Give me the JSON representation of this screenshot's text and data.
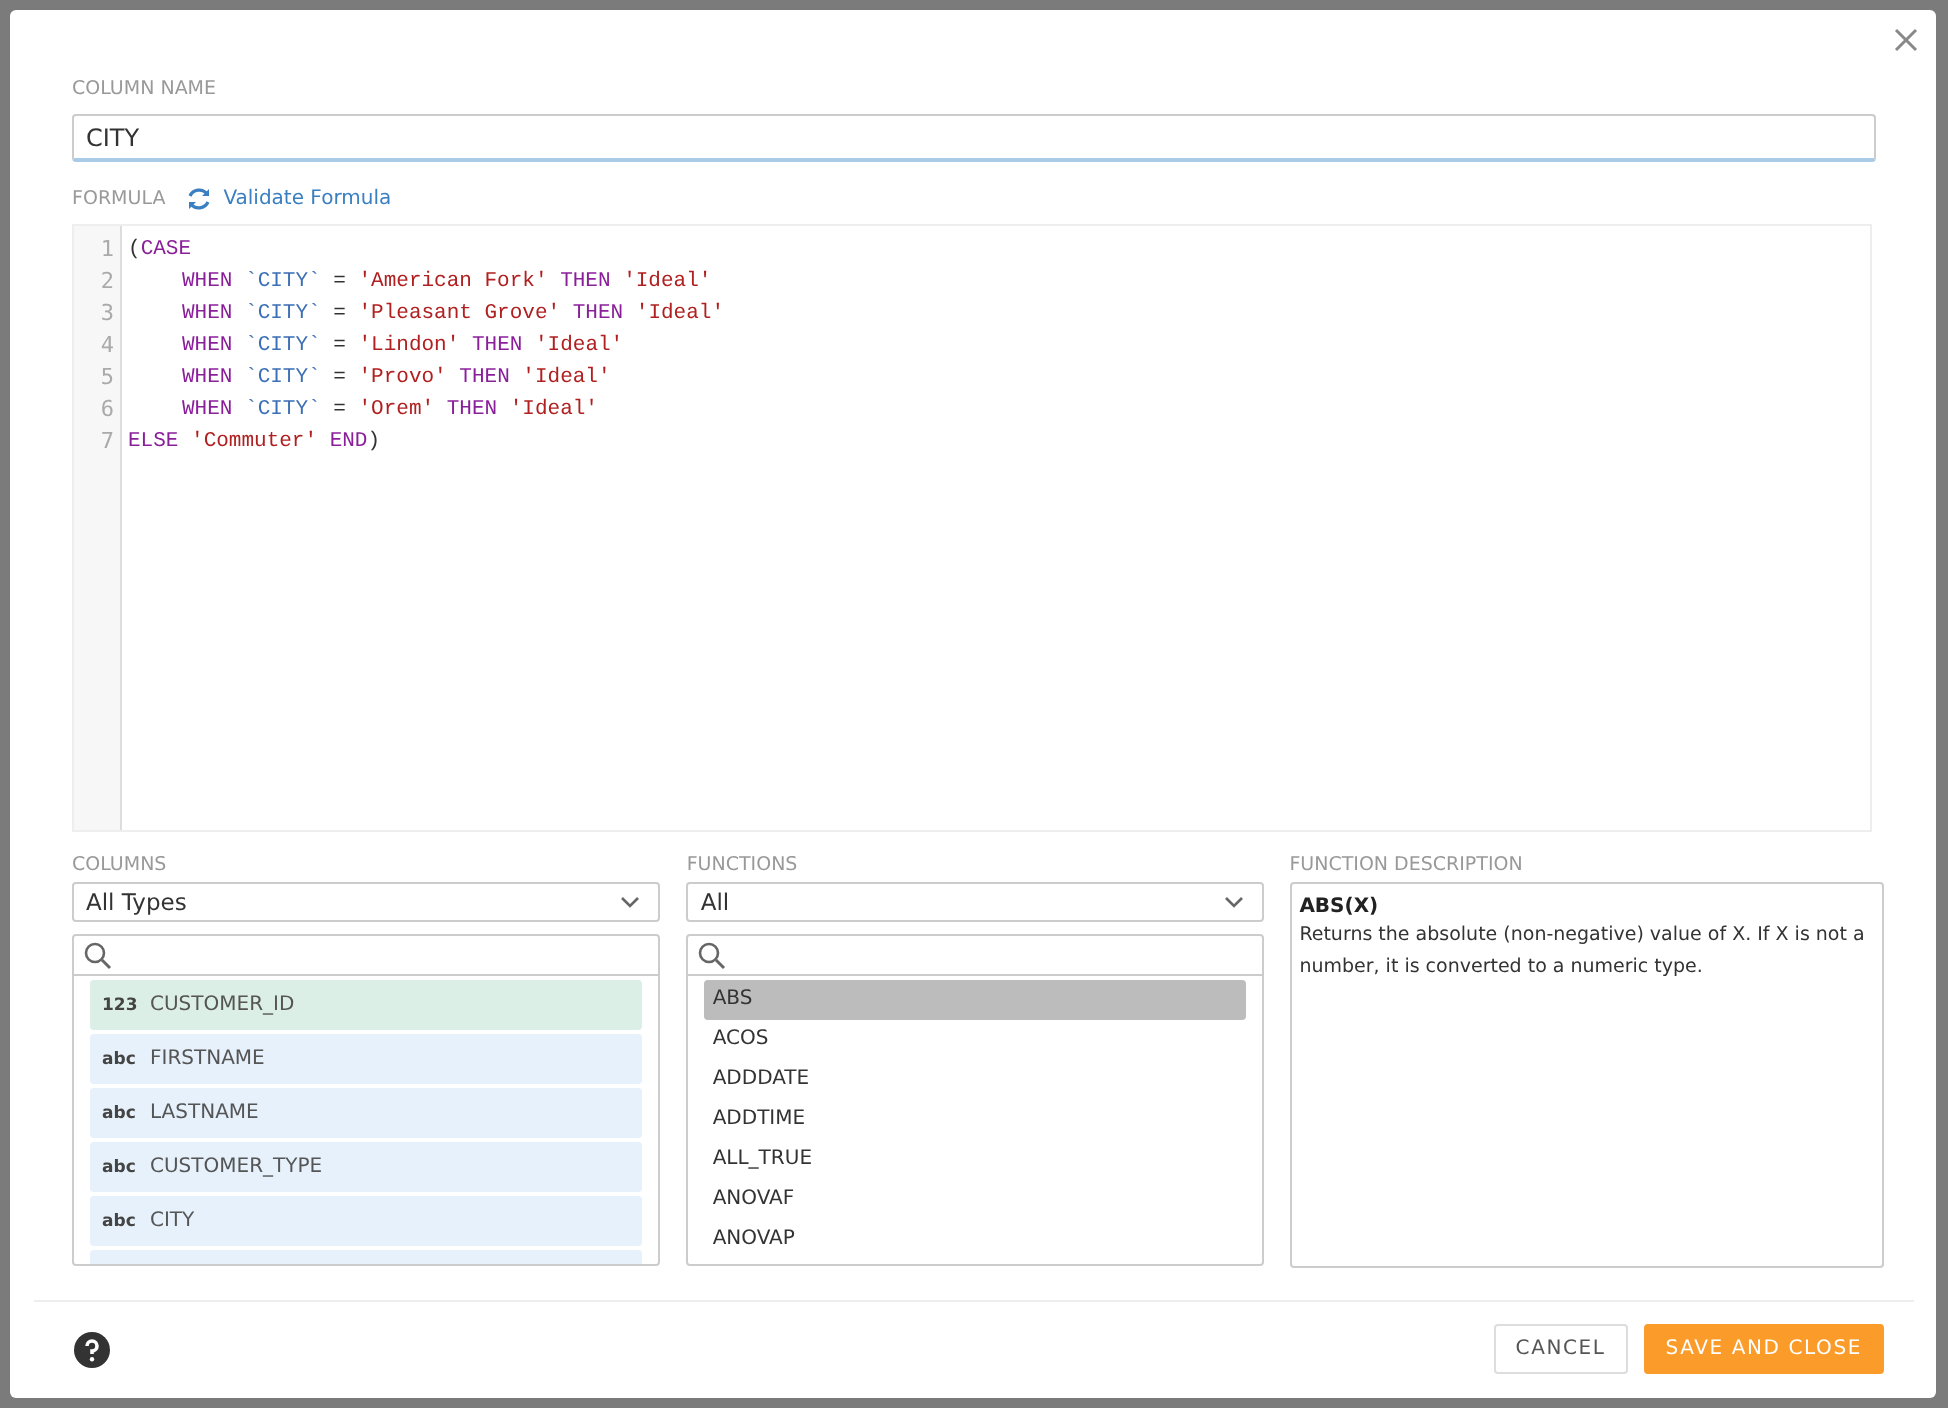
{
  "dialog": {
    "column_name": {
      "label": "COLUMN NAME",
      "value": "CITY"
    },
    "formula": {
      "label": "FORMULA",
      "validate_link": "Validate Formula",
      "lines": [
        {
          "number": "1",
          "indented": false,
          "tokens": [
            {
              "kind": "plain",
              "text": "("
            },
            {
              "kind": "keyword",
              "text": "CASE"
            }
          ]
        },
        {
          "number": "2",
          "indented": true,
          "tokens": [
            {
              "kind": "keyword",
              "text": "WHEN"
            },
            {
              "kind": "column",
              "text": " `CITY` "
            },
            {
              "kind": "plain",
              "text": "= "
            },
            {
              "kind": "string",
              "text": "'American Fork'"
            },
            {
              "kind": "keyword",
              "text": " THEN "
            },
            {
              "kind": "string",
              "text": "'Ideal'"
            }
          ]
        },
        {
          "number": "3",
          "indented": true,
          "tokens": [
            {
              "kind": "keyword",
              "text": "WHEN"
            },
            {
              "kind": "column",
              "text": " `CITY` "
            },
            {
              "kind": "plain",
              "text": "= "
            },
            {
              "kind": "string",
              "text": "'Pleasant Grove'"
            },
            {
              "kind": "keyword",
              "text": " THEN "
            },
            {
              "kind": "string",
              "text": "'Ideal'"
            }
          ]
        },
        {
          "number": "4",
          "indented": true,
          "tokens": [
            {
              "kind": "keyword",
              "text": "WHEN"
            },
            {
              "kind": "column",
              "text": " `CITY` "
            },
            {
              "kind": "plain",
              "text": "= "
            },
            {
              "kind": "string",
              "text": "'Lindon'"
            },
            {
              "kind": "keyword",
              "text": " THEN "
            },
            {
              "kind": "string",
              "text": "'Ideal'"
            }
          ]
        },
        {
          "number": "5",
          "indented": true,
          "tokens": [
            {
              "kind": "keyword",
              "text": "WHEN"
            },
            {
              "kind": "column",
              "text": " `CITY` "
            },
            {
              "kind": "plain",
              "text": "= "
            },
            {
              "kind": "string",
              "text": "'Provo'"
            },
            {
              "kind": "keyword",
              "text": " THEN "
            },
            {
              "kind": "string",
              "text": "'Ideal'"
            }
          ]
        },
        {
          "number": "6",
          "indented": true,
          "tokens": [
            {
              "kind": "keyword",
              "text": "WHEN"
            },
            {
              "kind": "column",
              "text": " `CITY` "
            },
            {
              "kind": "plain",
              "text": "= "
            },
            {
              "kind": "string",
              "text": "'Orem'"
            },
            {
              "kind": "keyword",
              "text": " THEN "
            },
            {
              "kind": "string",
              "text": "'Ideal'"
            }
          ]
        },
        {
          "number": "7",
          "indented": false,
          "tokens": [
            {
              "kind": "keyword",
              "text": "ELSE "
            },
            {
              "kind": "string",
              "text": "'Commuter'"
            },
            {
              "kind": "keyword",
              "text": " END"
            },
            {
              "kind": "plain",
              "text": ")"
            }
          ]
        }
      ]
    },
    "columns": {
      "label": "COLUMNS",
      "filter": "All Types",
      "items": [
        {
          "kind": "number",
          "type_badge": "123",
          "name": "CUSTOMER_ID"
        },
        {
          "kind": "text",
          "type_badge": "abc",
          "name": "FIRSTNAME"
        },
        {
          "kind": "text",
          "type_badge": "abc",
          "name": "LASTNAME"
        },
        {
          "kind": "text",
          "type_badge": "abc",
          "name": "CUSTOMER_TYPE"
        },
        {
          "kind": "text",
          "type_badge": "abc",
          "name": "CITY"
        }
      ]
    },
    "functions": {
      "label": "FUNCTIONS",
      "filter": "All",
      "items": [
        {
          "name": "ABS",
          "selected": true
        },
        {
          "name": "ACOS",
          "selected": false
        },
        {
          "name": "ADDDATE",
          "selected": false
        },
        {
          "name": "ADDTIME",
          "selected": false
        },
        {
          "name": "ALL_TRUE",
          "selected": false
        },
        {
          "name": "ANOVAF",
          "selected": false
        },
        {
          "name": "ANOVAP",
          "selected": false
        }
      ]
    },
    "function_description": {
      "label": "FUNCTION DESCRIPTION",
      "signature": "ABS(X)",
      "text": "Returns the absolute (non-negative) value of X. If X is not a number, it is converted to a numeric type."
    },
    "buttons": {
      "cancel": "CANCEL",
      "save": "SAVE AND CLOSE"
    }
  }
}
